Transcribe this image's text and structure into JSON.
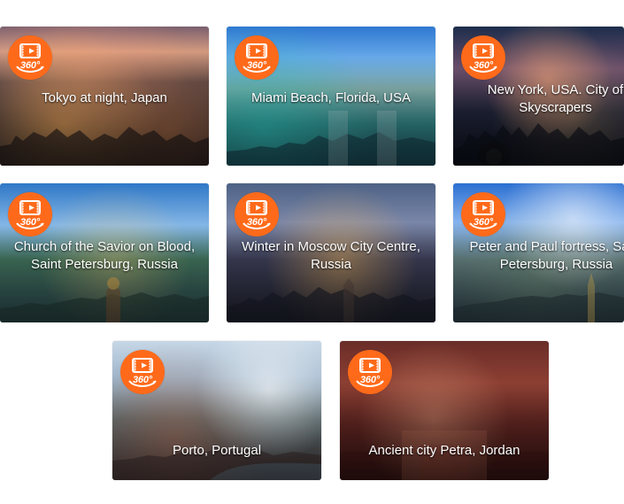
{
  "gallery": {
    "badge": {
      "text": "360°"
    },
    "items": [
      {
        "caption": "Tokyo at night, Japan"
      },
      {
        "caption": "Miami Beach, Florida, USA"
      },
      {
        "caption": "New York, USA. City of Skyscrapers"
      },
      {
        "caption": "Church of the Savior on Blood, Saint Petersburg, Russia"
      },
      {
        "caption": "Winter in Moscow City Centre, Russia"
      },
      {
        "caption": "Peter and Paul fortress, Saint Petersburg, Russia"
      },
      {
        "caption": "Porto, Portugal"
      },
      {
        "caption": "Ancient city Petra, Jordan"
      }
    ]
  },
  "colors": {
    "badge": "#ff6a1a",
    "caption": "#ffffff",
    "background": "#ffffff"
  },
  "icons": {
    "badge_icon": "video-360-icon"
  }
}
